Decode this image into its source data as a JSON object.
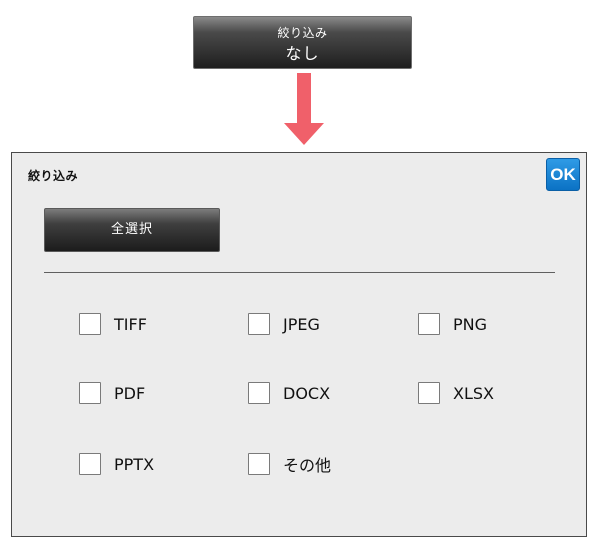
{
  "filter_summary": {
    "title": "絞り込み",
    "value": "なし"
  },
  "colors": {
    "arrow": "#f0606a",
    "ok_button": "#0b72c4",
    "dialog_background": "#ececec",
    "button_dark": "#2a2a2a"
  },
  "dialog": {
    "title": "絞り込み",
    "ok_label": "OK",
    "select_all_label": "全選択",
    "options": [
      {
        "label": "TIFF",
        "checked": false
      },
      {
        "label": "JPEG",
        "checked": false
      },
      {
        "label": "PNG",
        "checked": false
      },
      {
        "label": "PDF",
        "checked": false
      },
      {
        "label": "DOCX",
        "checked": false
      },
      {
        "label": "XLSX",
        "checked": false
      },
      {
        "label": "PPTX",
        "checked": false
      },
      {
        "label": "その他",
        "checked": false
      }
    ]
  }
}
